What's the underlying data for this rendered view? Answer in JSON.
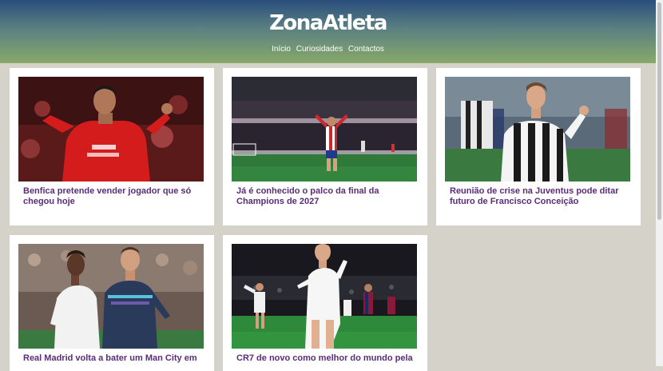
{
  "header": {
    "logo": "ZonaAtleta",
    "nav": [
      "Início",
      "Curiosidades",
      "Contactos"
    ]
  },
  "articles": [
    {
      "title": "Benfica pretende vender jogador que só chegou hoje",
      "image": "benfica-player-celebrating"
    },
    {
      "title": "Já é conhecido o palco da final da Champions de 2027",
      "image": "atletico-player-in-stadium"
    },
    {
      "title": "Reunião de crise na Juventus pode ditar futuro de Francisco Conceição",
      "image": "juventus-player-celebrating"
    },
    {
      "title": "Real Madrid volta a bater um Man City em",
      "image": "real-madrid-vs-man-city-players"
    },
    {
      "title": "CR7 de novo como melhor do mundo pela",
      "image": "ronaldo-celebrating-real-madrid"
    }
  ],
  "colors": {
    "background": "#d5d3c9",
    "header_top": "#2a4e7c",
    "header_bottom": "#87a96a",
    "title": "#5a2c7a"
  }
}
